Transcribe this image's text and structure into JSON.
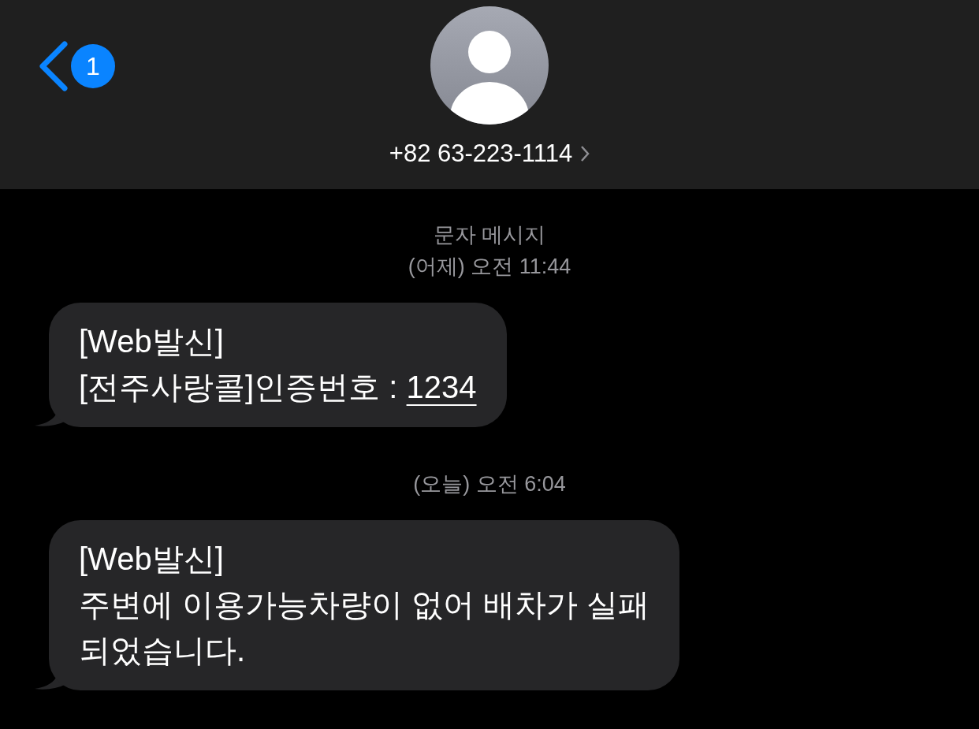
{
  "header": {
    "back_badge": "1",
    "contact": "+82 63-223-1114"
  },
  "items": [
    {
      "kind": "label",
      "text": "문자 메시지"
    },
    {
      "kind": "timestamp",
      "text": "(어제) 오전 11:44"
    },
    {
      "kind": "bubble",
      "lines": [
        "[Web발신]",
        "[전주사랑콜]인증번호 : "
      ],
      "link": "1234"
    },
    {
      "kind": "timestamp",
      "text": "(오늘) 오전 6:04"
    },
    {
      "kind": "bubble",
      "lines": [
        "[Web발신]",
        "주변에 이용가능차량이 없어 배차가 실패",
        "되었습니다."
      ]
    }
  ]
}
